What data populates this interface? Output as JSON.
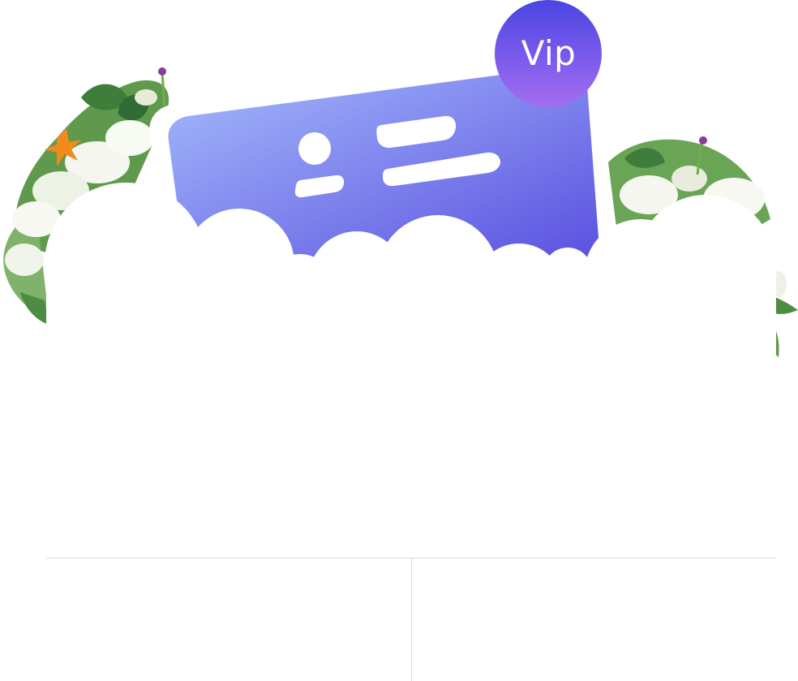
{
  "badge": {
    "label": "Vip",
    "gradient_top": "#4a45e4",
    "gradient_bottom": "#a56df0"
  },
  "card": {
    "gradient_start": "#a6bcfc",
    "gradient_end": "#5a51e0",
    "icon": "id-card-icon"
  },
  "decoration": {
    "left": "lily-bouquet-left",
    "right": "lily-bouquet-right"
  },
  "dialog": {
    "title": "",
    "message": "",
    "cancel_label": "",
    "confirm_label": "",
    "divider_color": "#dcdcdc"
  }
}
